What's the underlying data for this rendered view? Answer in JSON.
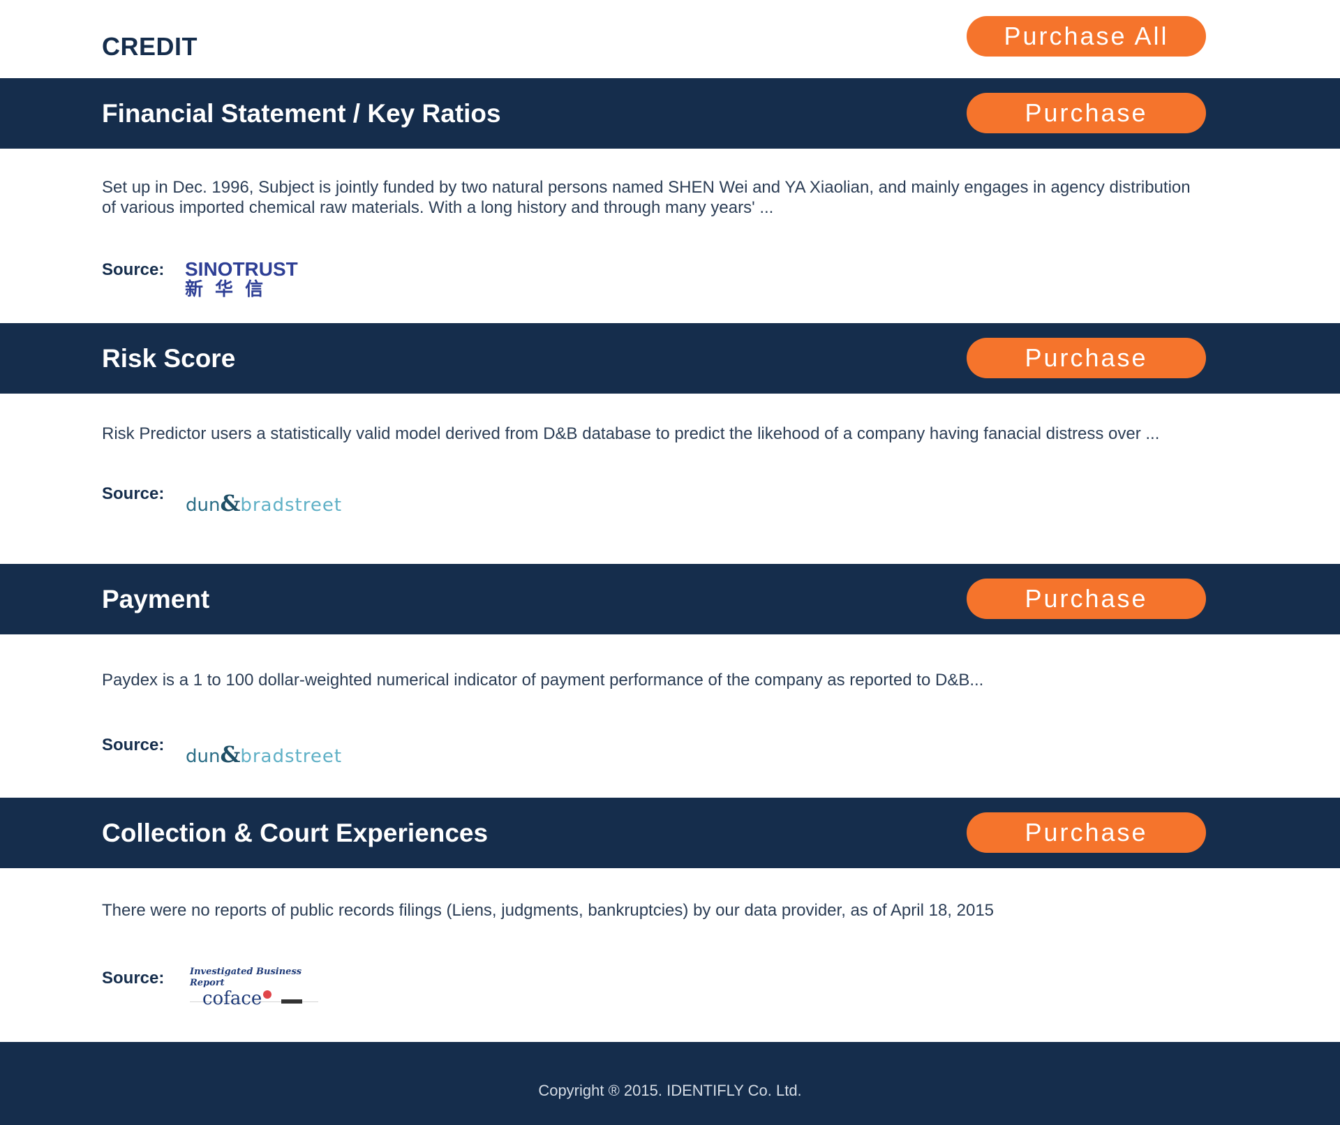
{
  "header": {
    "page_title": "CREDIT",
    "purchase_all_label": "Purchase All"
  },
  "sections": [
    {
      "title": "Financial Statement / Key Ratios",
      "button_label": "Purchase",
      "description": "Set up in Dec. 1996, Subject is jointly funded by two natural persons named SHEN Wei and YA Xiaolian, and mainly engages in agency distribution of various imported chemical raw materials. With a long history and through many years' ...",
      "source_label": "Source:",
      "source_logo": {
        "name": "sinotrust-logo",
        "text_en": "SINOTRUST",
        "text_cn": "新  华  信"
      }
    },
    {
      "title": "Risk Score",
      "button_label": "Purchase",
      "description": "Risk Predictor users a statistically valid model derived from D&B database to predict the likehood of a company having fanacial distress over ...",
      "source_label": "Source:",
      "source_logo": {
        "name": "dun-bradstreet-logo",
        "text_a": "dun",
        "text_amp": "&",
        "text_b": "bradstreet"
      }
    },
    {
      "title": "Payment",
      "button_label": "Purchase",
      "description": "Paydex is a 1 to 100 dollar-weighted numerical indicator of payment performance of the company as reported to D&B...",
      "source_label": "Source:",
      "source_logo": {
        "name": "dun-bradstreet-logo",
        "text_a": "dun",
        "text_amp": "&",
        "text_b": "bradstreet"
      }
    },
    {
      "title": "Collection & Court Experiences",
      "button_label": "Purchase",
      "description": "There were no reports of public records filings (Liens, judgments, bankruptcies) by our data provider, as of April 18, 2015",
      "source_label": "Source:",
      "source_logo": {
        "name": "coface-logo",
        "text_top": "Investigated Business Report",
        "text_main": "coface"
      }
    }
  ],
  "footer": {
    "copyright": "Copyright ® 2015. IDENTIFLY Co. Ltd."
  },
  "colors": {
    "navy": "#152d4c",
    "orange": "#f5742c",
    "dnb_dark": "#2a6d86",
    "dnb_light": "#5fb0c6",
    "sinotrust": "#2e3f95"
  }
}
